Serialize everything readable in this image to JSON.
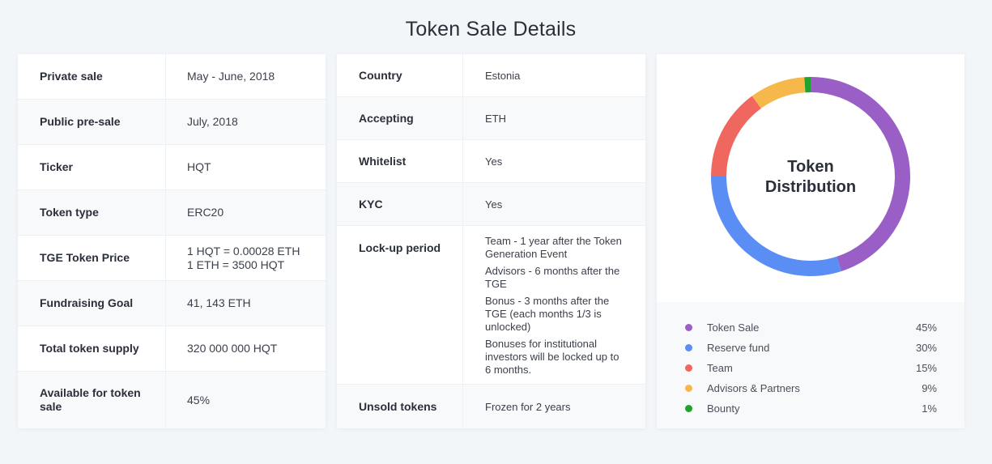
{
  "title": "Token Sale Details",
  "sale_details": [
    {
      "key": "Private sale",
      "value": "May - June, 2018"
    },
    {
      "key": "Public pre-sale",
      "value": "July, 2018"
    },
    {
      "key": "Ticker",
      "value": "HQT"
    },
    {
      "key": "Token type",
      "value": "ERC20"
    },
    {
      "key": "TGE Token Price",
      "value": "1 HQT = 0.00028 ETH",
      "value2": "1 ETH = 3500 HQT"
    },
    {
      "key": "Fundraising Goal",
      "value": "41, 143 ETH"
    },
    {
      "key": "Total token supply",
      "value": "320 000 000 HQT"
    },
    {
      "key": "Available for token sale",
      "value": "45%"
    }
  ],
  "sale_terms": {
    "country": {
      "key": "Country",
      "value": "Estonia"
    },
    "accepting": {
      "key": "Accepting",
      "value": "ETH"
    },
    "whitelist": {
      "key": "Whitelist",
      "value": "Yes"
    },
    "kyc": {
      "key": "KYC",
      "value": "Yes"
    },
    "lockup": {
      "key": "Lock-up period",
      "items": [
        "Team - 1 year after the Token Generation Event",
        "Advisors - 6 months after the TGE",
        "Bonus - 3 months after the TGE (each months 1/3 is unlocked)",
        "Bonuses for institutional investors will be locked up to 6 months."
      ]
    },
    "unsold": {
      "key": "Unsold tokens",
      "value": "Frozen for 2 years"
    }
  },
  "distribution": {
    "label_line1": "Token",
    "label_line2": "Distribution",
    "items": [
      {
        "name": "Token Sale",
        "percent": 45,
        "percent_label": "45%",
        "color": "#9a5fc6"
      },
      {
        "name": "Reserve fund",
        "percent": 30,
        "percent_label": "30%",
        "color": "#5b8ef5"
      },
      {
        "name": "Team",
        "percent": 15,
        "percent_label": "15%",
        "color": "#f0675f"
      },
      {
        "name": "Advisors & Partners",
        "percent": 9,
        "percent_label": "9%",
        "color": "#f7b84b"
      },
      {
        "name": "Bounty",
        "percent": 1,
        "percent_label": "1%",
        "color": "#1fa32c"
      }
    ]
  }
}
